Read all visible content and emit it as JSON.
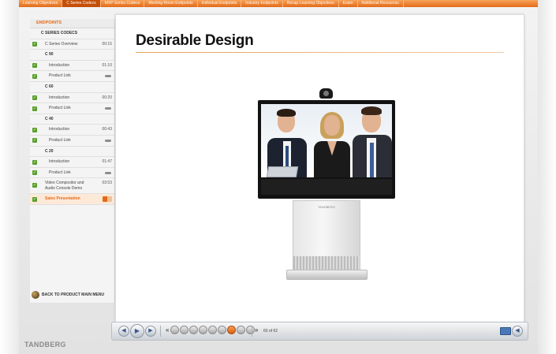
{
  "nav_tabs": [
    {
      "label": "Learning Objectives"
    },
    {
      "label": "C Series Codecs"
    },
    {
      "label": "MXP Series Codecs"
    },
    {
      "label": "Meeting Room Endpoints"
    },
    {
      "label": "Individual Endpoints"
    },
    {
      "label": "Industry Endpoints"
    },
    {
      "label": "Recap Learning Objectives"
    },
    {
      "label": "Exam"
    },
    {
      "label": "Additional Resources"
    }
  ],
  "active_tab": "C Series Codecs",
  "sidebar": {
    "header": "ENDPOINTS",
    "section": "C SERIES CODECS",
    "items": [
      {
        "label": "C Series Overview",
        "duration": "00:15"
      },
      {
        "label": "C 90"
      },
      {
        "label": "Introduction",
        "duration": "01:10"
      },
      {
        "label": "Product Link"
      },
      {
        "label": "C 60"
      },
      {
        "label": "Introduction",
        "duration": "00:20"
      },
      {
        "label": "Product Link"
      },
      {
        "label": "C 40"
      },
      {
        "label": "Introduction",
        "duration": "00:43"
      },
      {
        "label": "Product Link"
      },
      {
        "label": "C 20"
      },
      {
        "label": "Introduction",
        "duration": "01:47"
      },
      {
        "label": "Product Link"
      },
      {
        "label": "Video Compositor and Audio Console Demo",
        "duration": "03:53"
      },
      {
        "label": "Sales Presentation"
      }
    ],
    "back_label": "BACK TO PRODUCT MAIN MENU"
  },
  "content": {
    "title": "Desirable Design",
    "stand_brand": "TANDBERG"
  },
  "player": {
    "page_dots": [
      "",
      "",
      "",
      "",
      "",
      "",
      "",
      "",
      "",
      ""
    ],
    "page_count": "60 of 62"
  },
  "brand": "TANDBERG",
  "colors": {
    "accent": "#e36a18",
    "check": "#5aa02c"
  }
}
